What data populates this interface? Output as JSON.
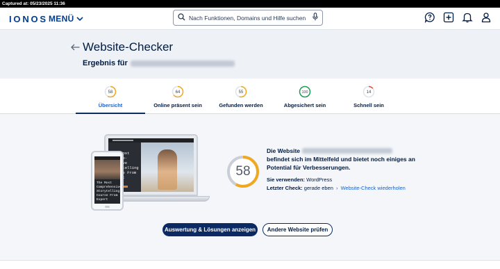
{
  "capture": {
    "text": "Captured at: 05/23/2025 11:36"
  },
  "header": {
    "logo": "IONOS",
    "menu_label": "MENÜ",
    "search_placeholder": "Nach Funktionen, Domains und Hilfe suchen",
    "icons": [
      "help-chat-icon",
      "add-icon",
      "bell-icon",
      "user-icon"
    ]
  },
  "hero": {
    "title": "Website-Checker",
    "result_prefix": "Ergebnis für"
  },
  "tabs": [
    {
      "label": "Übersicht",
      "score": "58",
      "ratio": 0.58,
      "color": "#f0a81e",
      "active": true
    },
    {
      "label": "Online präsent sein",
      "score": "64",
      "ratio": 0.64,
      "color": "#f0a81e",
      "active": false
    },
    {
      "label": "Gefunden werden",
      "score": "55",
      "ratio": 0.55,
      "color": "#f0a81e",
      "active": false
    },
    {
      "label": "Abgesichert sein",
      "score": "100",
      "ratio": 1.0,
      "color": "#1f9d55",
      "active": false
    },
    {
      "label": "Schnell sein",
      "score": "14",
      "ratio": 0.14,
      "color": "#e2483d",
      "active": false
    }
  ],
  "preview": {
    "laptop_text": "The Most Compre- hensive Storytelling Course From Expert",
    "phone_text": "The Most Comprehensive Storytelling Course From Expert"
  },
  "summary": {
    "score": "58",
    "score_ratio": 0.58,
    "score_color": "#f0a81e",
    "line1_prefix": "Die Website",
    "line2": "befindet sich im Mittelfeld und bietet noch einiges an",
    "line3": "Potential für Verbesserungen.",
    "uses_label": "Sie verwenden:",
    "uses_value": "WordPress",
    "check_label": "Letzter Check:",
    "check_value": "gerade eben",
    "recheck_link": "Website-Check wiederholen"
  },
  "buttons": {
    "primary": "Auswertung & Lösungen anzeigen",
    "secondary": "Andere Website prüfen"
  },
  "colors": {
    "brand": "#003d8f",
    "primary_button": "#0b2a63",
    "link": "#1d62c7"
  }
}
